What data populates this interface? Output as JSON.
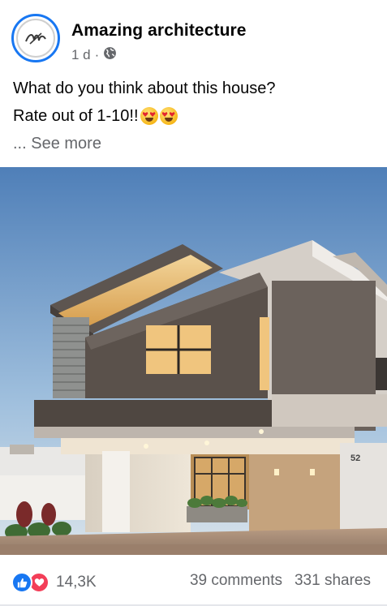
{
  "post": {
    "page_name": "Amazing architecture",
    "time": "1 d",
    "separator": "·",
    "audience_icon": "globe-icon",
    "avatar_icon": "am-monogram-logo",
    "text_line1": "What do you think about this house?",
    "text_line2": "Rate out of 1-10!!",
    "emojis": [
      "heart-eyes-emoji",
      "heart-eyes-emoji"
    ],
    "see_more": "... See more",
    "house_number": "52"
  },
  "footer": {
    "reaction_icons": [
      "like-icon",
      "love-icon"
    ],
    "reaction_count": "14,3K",
    "comments": "39 comments",
    "shares": "331 shares"
  },
  "colors": {
    "accent": "#1877f2",
    "love": "#f33e58",
    "secondary_text": "#65676b"
  }
}
